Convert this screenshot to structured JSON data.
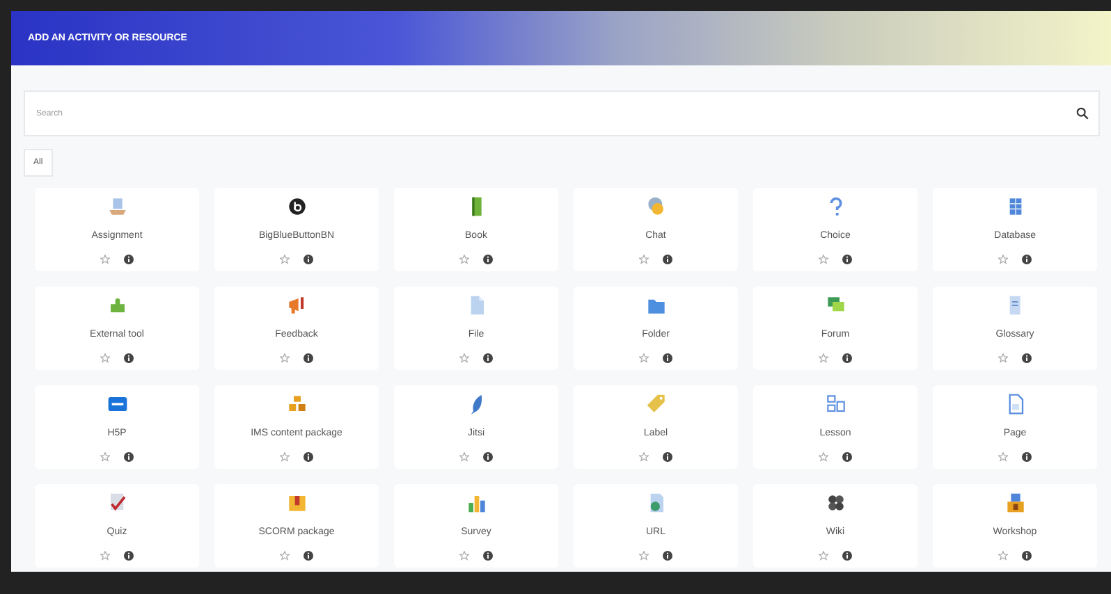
{
  "dialog": {
    "title": "ADD AN ACTIVITY OR RESOURCE"
  },
  "search": {
    "placeholder": "Search"
  },
  "tabs": [
    {
      "label": "All",
      "selected": true
    }
  ],
  "items": [
    {
      "name": "Assignment"
    },
    {
      "name": "BigBlueButtonBN"
    },
    {
      "name": "Book"
    },
    {
      "name": "Chat"
    },
    {
      "name": "Choice"
    },
    {
      "name": "Database"
    },
    {
      "name": "External tool"
    },
    {
      "name": "Feedback"
    },
    {
      "name": "File"
    },
    {
      "name": "Folder"
    },
    {
      "name": "Forum"
    },
    {
      "name": "Glossary"
    },
    {
      "name": "H5P"
    },
    {
      "name": "IMS content package"
    },
    {
      "name": "Jitsi"
    },
    {
      "name": "Label"
    },
    {
      "name": "Lesson"
    },
    {
      "name": "Page"
    },
    {
      "name": "Quiz"
    },
    {
      "name": "SCORM package"
    },
    {
      "name": "Survey"
    },
    {
      "name": "URL"
    },
    {
      "name": "Wiki"
    },
    {
      "name": "Workshop"
    }
  ]
}
